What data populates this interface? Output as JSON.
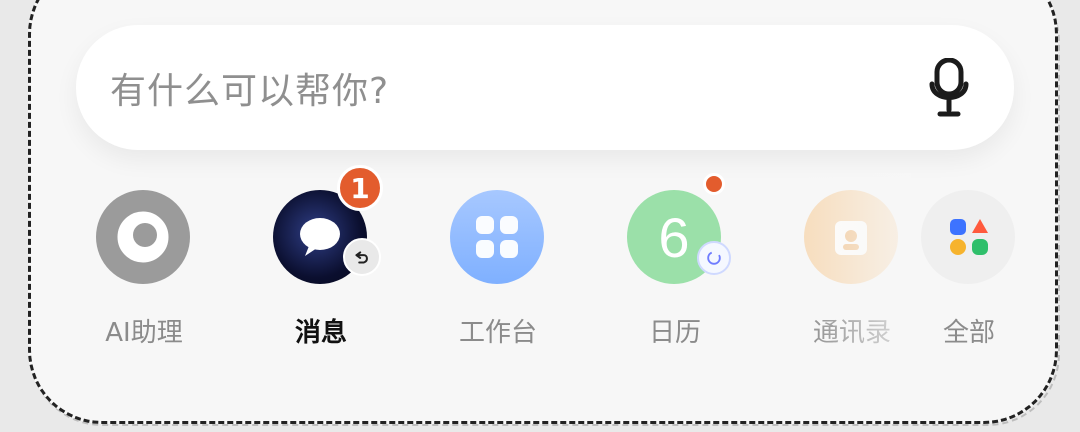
{
  "search": {
    "placeholder": "有什么可以帮你?",
    "mic_icon": "mic-icon"
  },
  "apps": [
    {
      "label": "AI助理",
      "icon": "ai-assistant-icon"
    },
    {
      "label": "消息",
      "icon": "messages-icon",
      "badge_count": "1",
      "secondary_icon": "undo-icon",
      "active": true
    },
    {
      "label": "工作台",
      "icon": "workbench-icon"
    },
    {
      "label": "日历",
      "icon": "calendar-icon",
      "icon_text": "6",
      "dot": "red",
      "secondary_icon": "sync-icon"
    },
    {
      "label": "通讯录",
      "icon": "contacts-icon",
      "truncated_label": "通讯录"
    },
    {
      "label": "全部",
      "icon": "all-apps-icon"
    }
  ],
  "colors": {
    "badge": "#e35c2d",
    "calendar": "#9be0a9",
    "workbench": "#7fb0ff",
    "ai": "#9b9b9b"
  }
}
